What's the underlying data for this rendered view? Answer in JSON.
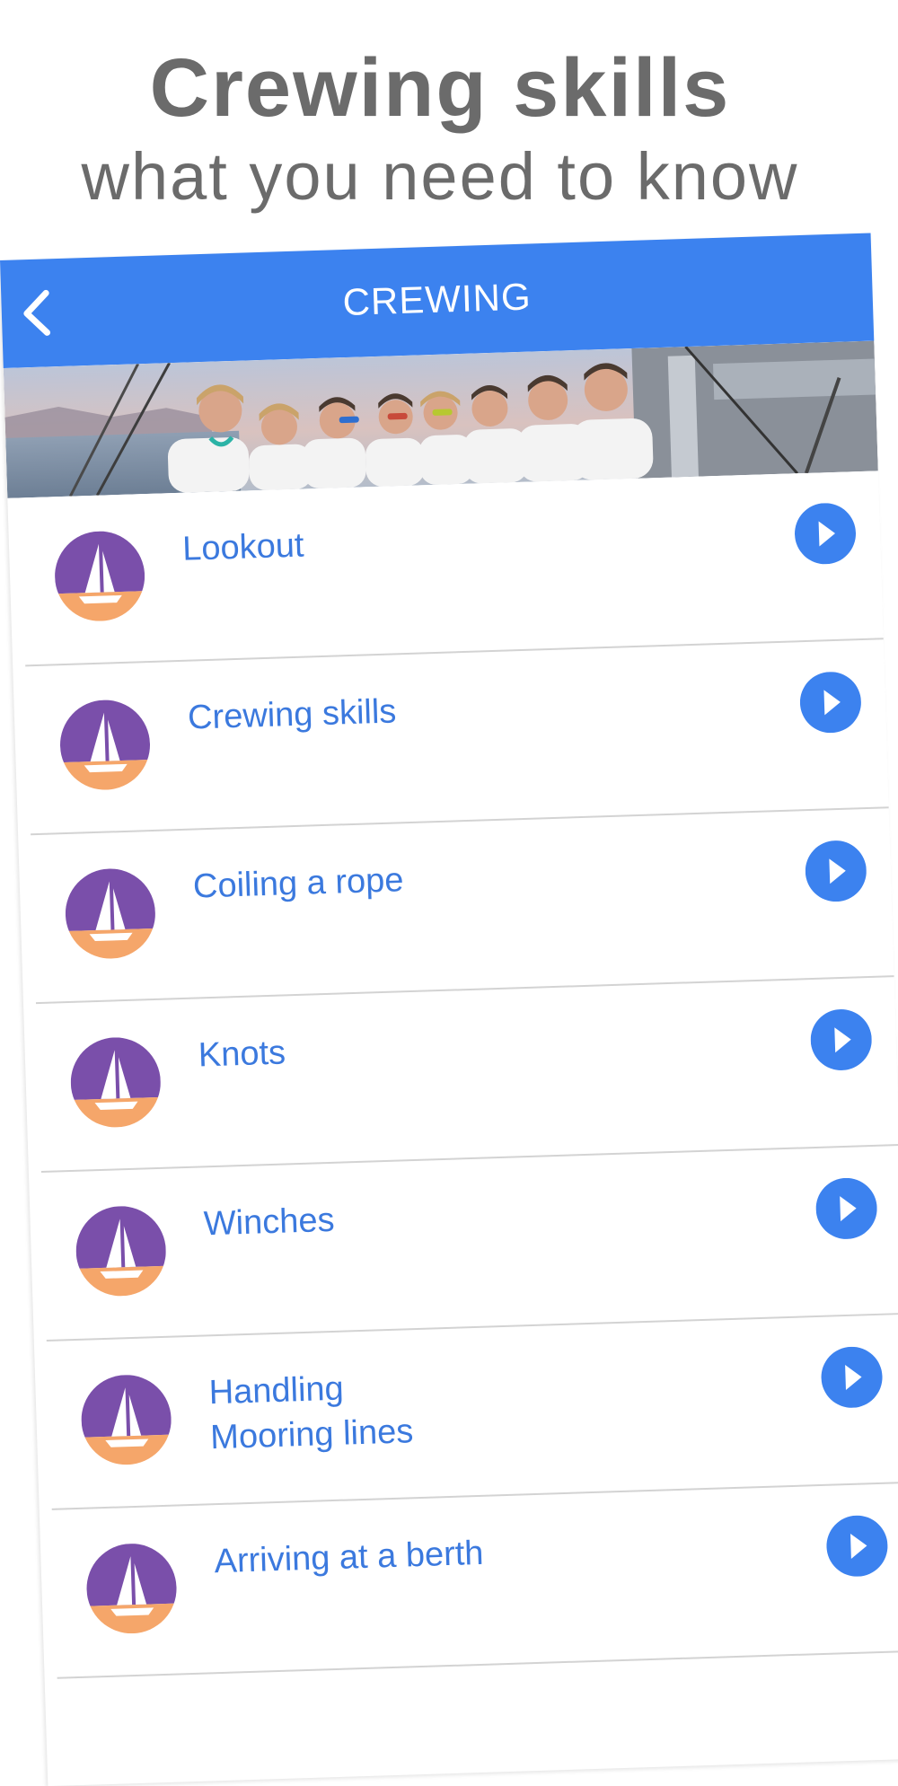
{
  "promo": {
    "title": "Crewing skills",
    "subtitle": "what you need to know"
  },
  "navbar": {
    "title": "CREWING",
    "back_icon": "chevron-left-icon",
    "color": "#3c82ef"
  },
  "hero_image": "crew-photo",
  "list": {
    "item_icon": "sailboat-icon",
    "action_icon": "play-circle-icon",
    "items": [
      {
        "label": "Lookout"
      },
      {
        "label": "Crewing skills"
      },
      {
        "label": "Coiling a rope"
      },
      {
        "label": "Knots"
      },
      {
        "label": "Winches"
      },
      {
        "label": "Handling\nMooring lines"
      },
      {
        "label": "Arriving at a berth"
      }
    ]
  },
  "colors": {
    "accent": "#3c82ef",
    "label": "#3b79de",
    "icon_purple": "#7a4faa",
    "icon_orange": "#f5a66a",
    "promo_text": "#6b6b6b"
  }
}
